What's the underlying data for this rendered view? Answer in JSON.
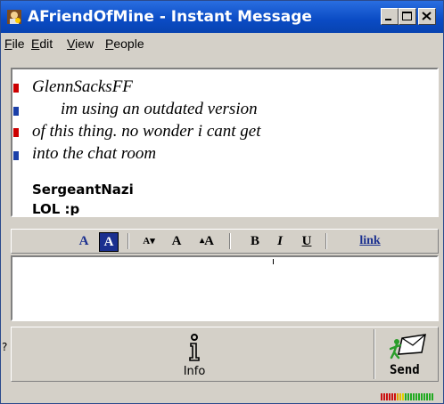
{
  "window": {
    "title": "AFriendOfMine - Instant Message",
    "controls": {
      "minimize": "_",
      "maximize": "□",
      "close": "×"
    }
  },
  "menu": {
    "items": [
      {
        "first": "F",
        "rest": "ile"
      },
      {
        "first": "E",
        "rest": "dit"
      },
      {
        "first": "V",
        "rest": "iew"
      },
      {
        "first": "P",
        "rest": "eople"
      }
    ]
  },
  "conversation": {
    "sender1": "GlennSacksFF",
    "message1_lines": [
      "im using an outdated version",
      "of this thing. no wonder i cant get",
      "into the chat room"
    ],
    "sender2": "SergeantNazi",
    "message2": "LOL :p"
  },
  "format_toolbar": {
    "text_color": "A",
    "bg_color": "A",
    "smaller_font": "A",
    "normal_font": "A",
    "larger_font": "A",
    "bold": "B",
    "italic": "I",
    "underline": "U",
    "link": "link"
  },
  "input": {
    "value": ""
  },
  "actions": {
    "info_label": "Info",
    "send_label": "Send"
  },
  "side_glyph": "?",
  "colors": {
    "titlebar": "#0a4bc4",
    "toolbar_accent": "#1a2f8f",
    "meter_red": "#cc1111",
    "meter_green": "#22aa22"
  }
}
